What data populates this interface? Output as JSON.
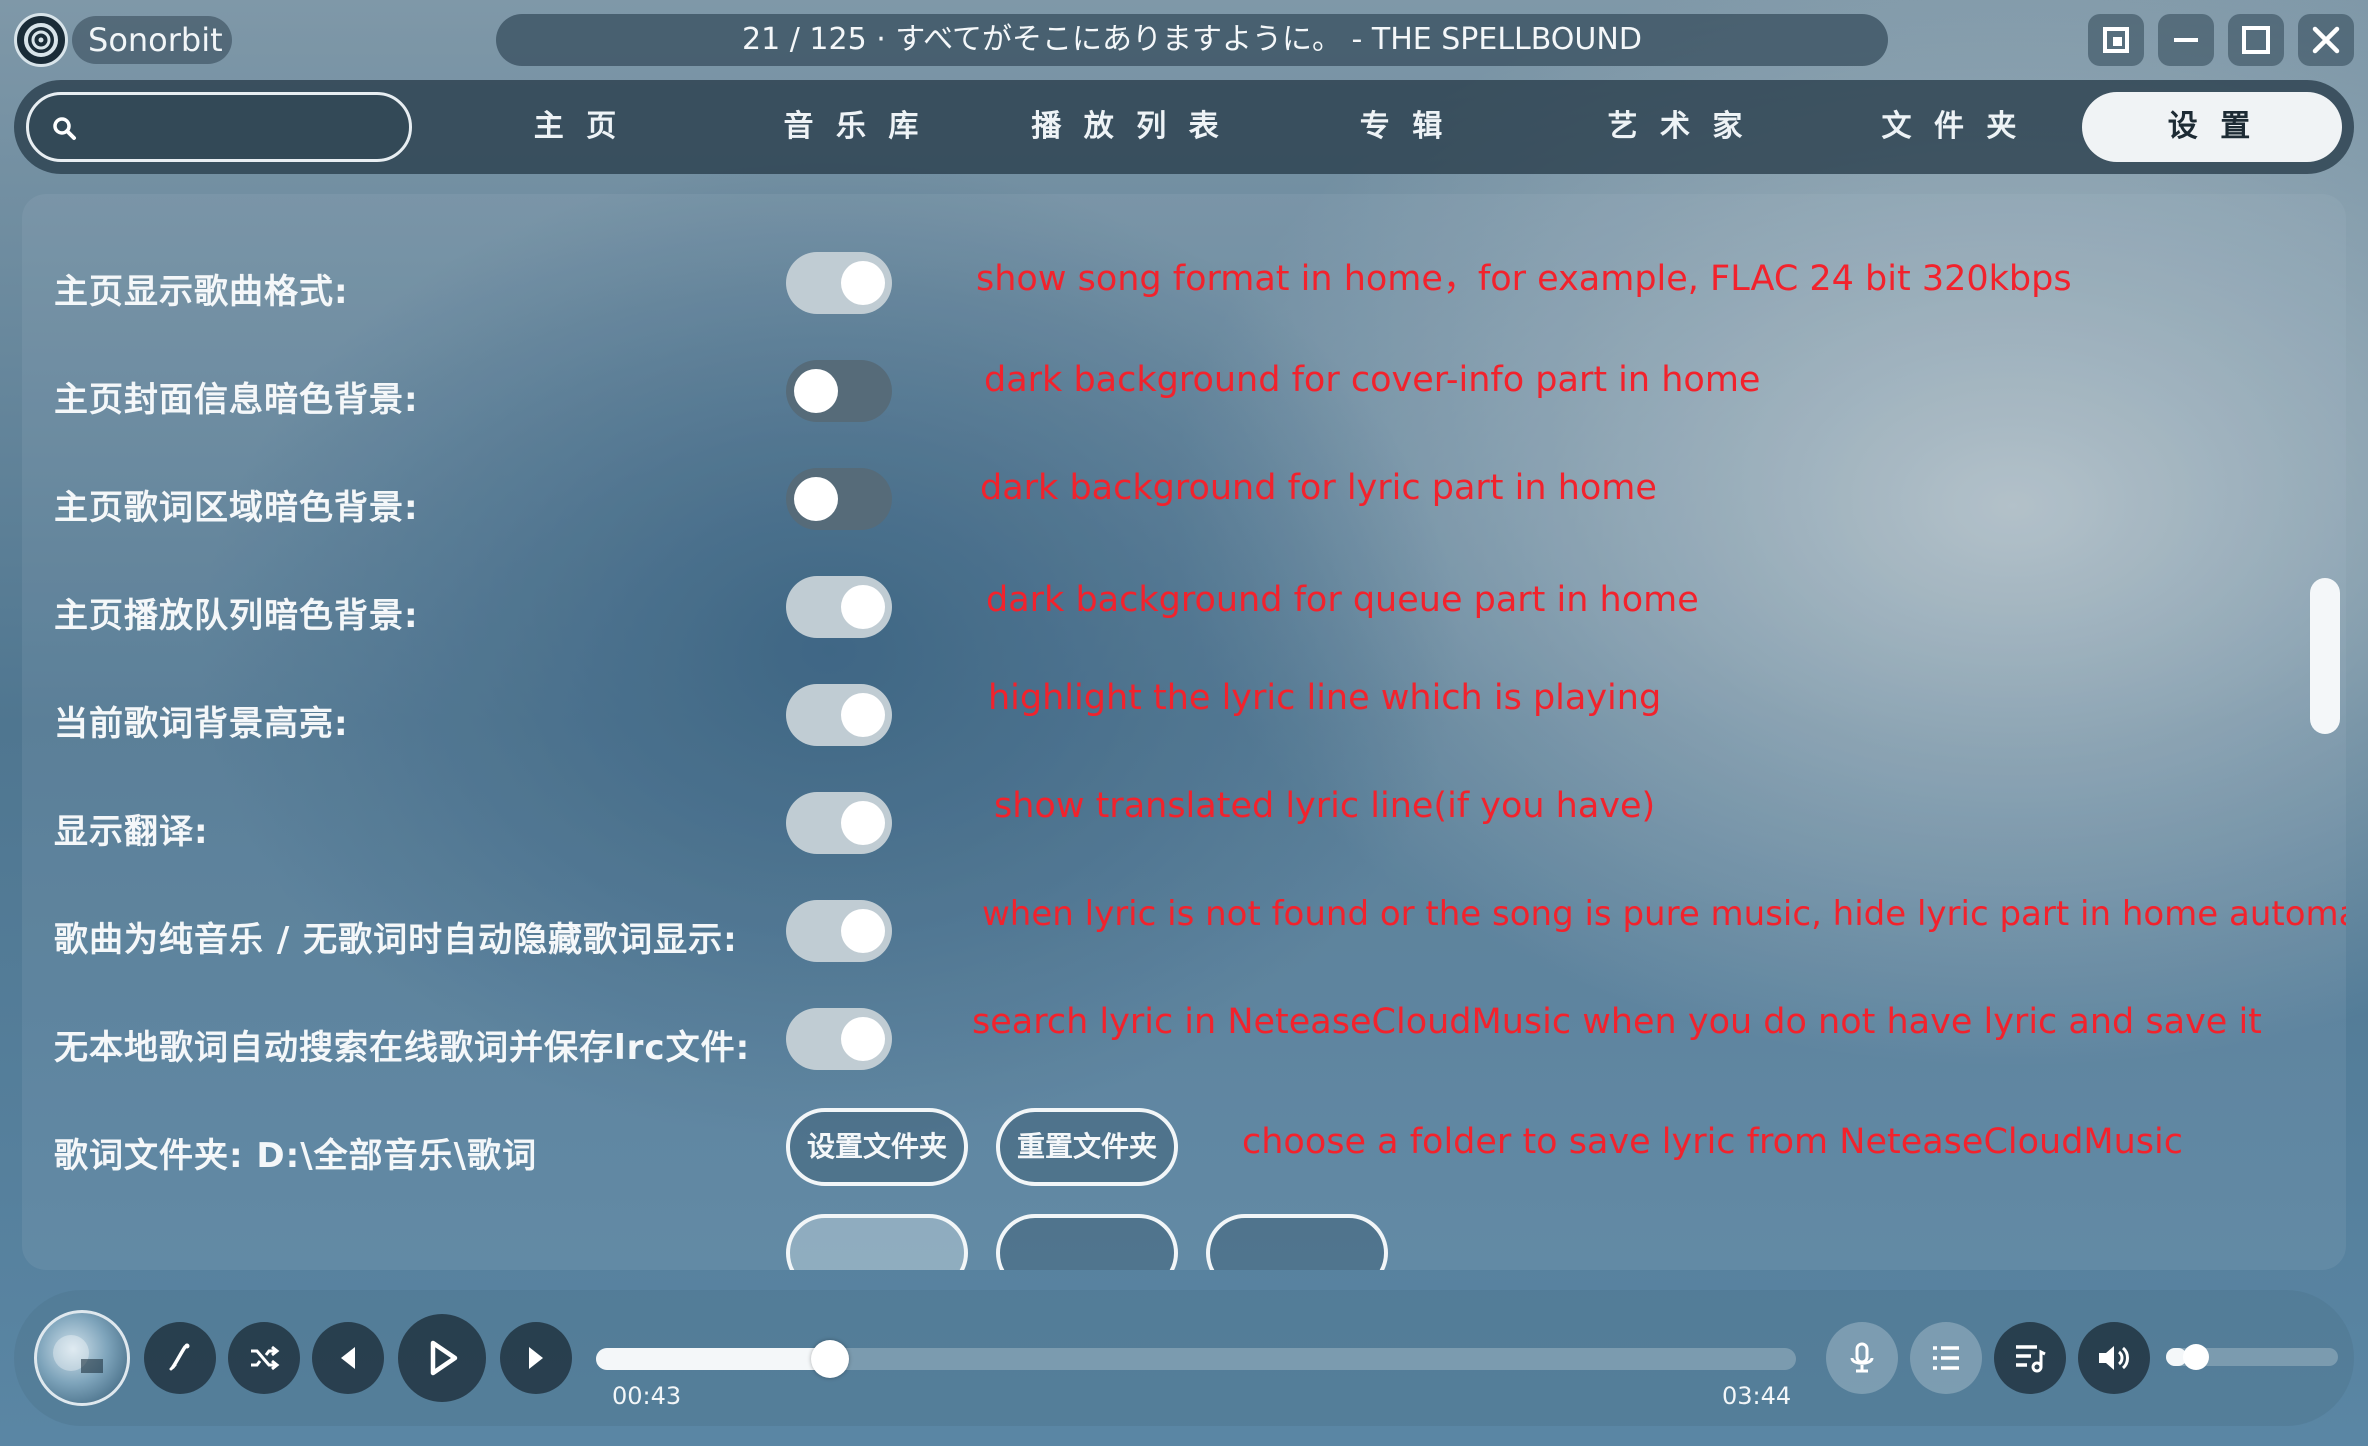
{
  "app": {
    "name": "Sonorbit",
    "now_playing": "21 / 125 · すべてがそこにありますように。 - THE SPELLBOUND"
  },
  "window_controls": [
    "restore-icon",
    "minimize-icon",
    "maximize-icon",
    "close-icon"
  ],
  "search": {
    "value": "",
    "placeholder": "",
    "icon": "search-icon"
  },
  "nav": {
    "tabs": [
      {
        "label": "主 页"
      },
      {
        "label": "音 乐 库"
      },
      {
        "label": "播 放 列 表"
      },
      {
        "label": "专 辑"
      },
      {
        "label": "艺 术 家"
      },
      {
        "label": "文 件 夹"
      },
      {
        "label": "设 置",
        "active": true
      }
    ]
  },
  "settings": {
    "rows": [
      {
        "label": "主页显示歌曲格式:",
        "state": "on",
        "annotation": "show song format in home，for example, FLAC 24 bit 320kbps"
      },
      {
        "label": "主页封面信息暗色背景:",
        "state": "off",
        "annotation": "dark background for cover-info part in home"
      },
      {
        "label": "主页歌词区域暗色背景:",
        "state": "off",
        "annotation": "dark background for lyric part in home"
      },
      {
        "label": "主页播放队列暗色背景:",
        "state": "on",
        "annotation": "dark background for queue part in home"
      },
      {
        "label": "当前歌词背景高亮:",
        "state": "on",
        "annotation": "highlight the lyric line which is playing"
      },
      {
        "label": "显示翻译:",
        "state": "on",
        "annotation": "show translated lyric line(if you have)"
      },
      {
        "label": "歌曲为纯音乐 / 无歌词时自动隐藏歌词显示:",
        "state": "on",
        "annotation": "when lyric is not found or the song is pure music, hide lyric part in home automatically"
      },
      {
        "label": "无本地歌词自动搜索在线歌词并保存lrc文件:",
        "state": "on",
        "annotation": "search lyric in NeteaseCloudMusic when you do not have lyric and save it"
      }
    ],
    "folder_row": {
      "label": "歌词文件夹: D:\\全部音乐\\歌词",
      "set_button": "设置文件夹",
      "reset_button": "重置文件夹",
      "annotation": "choose a folder to save lyric from NeteaseCloudMusic"
    }
  },
  "player": {
    "elapsed": "00:43",
    "duration": "03:44",
    "progress": 0.195,
    "volume": 0.12,
    "controls": [
      "lyric-edit-icon",
      "shuffle-icon",
      "previous-icon",
      "play-icon",
      "next-icon"
    ],
    "right_controls": [
      "microphone-icon",
      "list-icon",
      "queue-icon",
      "volume-icon"
    ]
  },
  "colors": {
    "annotation": "#f2222c",
    "toggle_on": "#c0ccd3",
    "toggle_off": "#566b79",
    "active_tab": "#f0f3f5"
  }
}
